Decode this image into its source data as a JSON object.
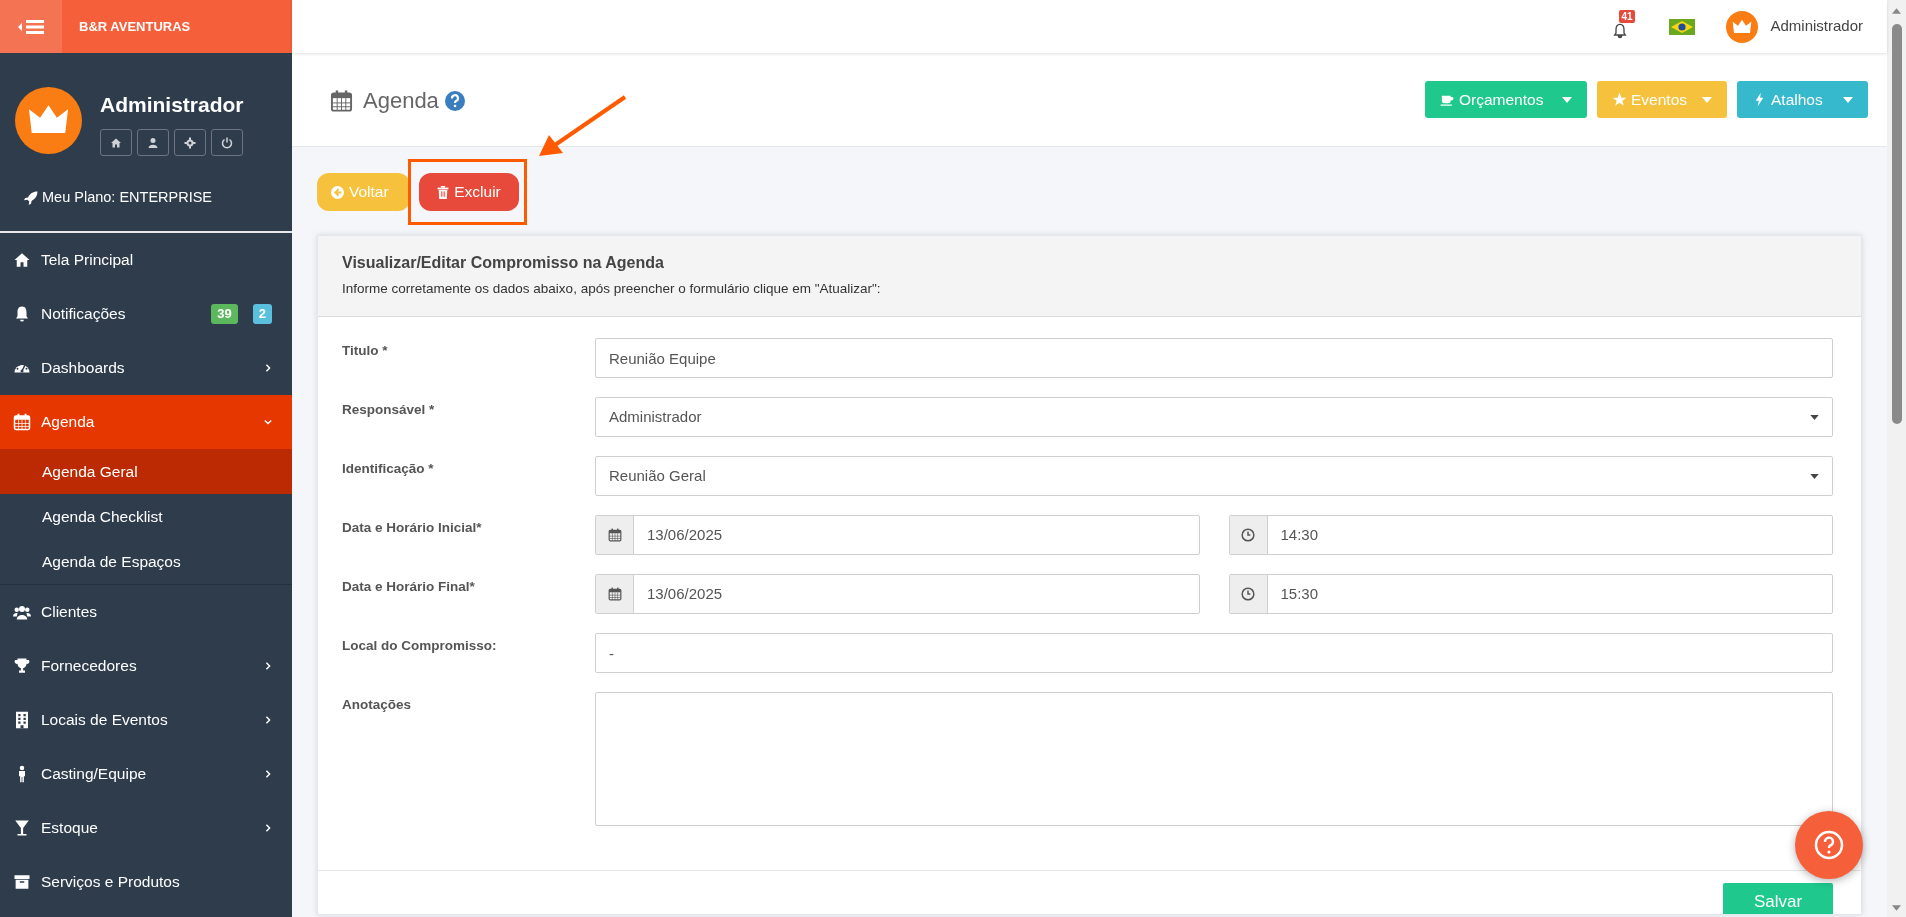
{
  "topbar": {
    "brand": "B&R AVENTURAS",
    "notification_count": "41",
    "user": "Administrador"
  },
  "profile": {
    "name": "Administrador",
    "plan": "Meu Plano: ENTERPRISE"
  },
  "sidebar": {
    "items": [
      {
        "label": "Tela Principal",
        "kind": "link",
        "selected": false
      },
      {
        "label": "Notificações",
        "kind": "link",
        "selected": false,
        "badges": [
          {
            "text": "39",
            "color": "#5cb85c"
          },
          {
            "text": "2",
            "color": "#5bc0de"
          }
        ]
      },
      {
        "label": "Dashboards",
        "kind": "menu",
        "selected": false,
        "expanded": false
      },
      {
        "label": "Agenda",
        "kind": "menu",
        "selected": true,
        "expanded": true,
        "children": [
          {
            "label": "Agenda Geral",
            "selected": true
          },
          {
            "label": "Agenda Checklist",
            "selected": false
          },
          {
            "label": "Agenda de Espaços",
            "selected": false
          }
        ]
      },
      {
        "label": "Clientes",
        "kind": "link",
        "selected": false
      },
      {
        "label": "Fornecedores",
        "kind": "menu",
        "selected": false,
        "expanded": false
      },
      {
        "label": "Locais de Eventos",
        "kind": "menu",
        "selected": false,
        "expanded": false
      },
      {
        "label": "Casting/Equipe",
        "kind": "menu",
        "selected": false,
        "expanded": false
      },
      {
        "label": "Estoque",
        "kind": "menu",
        "selected": false,
        "expanded": false
      },
      {
        "label": "Serviços e Produtos",
        "kind": "link",
        "selected": false
      }
    ]
  },
  "page_header": {
    "title": "Agenda",
    "buttons": [
      {
        "label": "Orçamentos",
        "color": "#1fc98e"
      },
      {
        "label": "Eventos",
        "color": "#f6c23e"
      },
      {
        "label": "Atalhos",
        "color": "#36b9cc"
      }
    ]
  },
  "actions": [
    {
      "label": "Voltar",
      "color": "#f6c23e",
      "highlighted": false
    },
    {
      "label": "Excluir",
      "color": "#e74a3b",
      "highlighted": true
    }
  ],
  "card": {
    "title": "Visualizar/Editar Compromisso na Agenda",
    "subtitle": "Informe corretamente os dados abaixo, após preencher o formulário clique em \"Atualizar\":",
    "fields": [
      {
        "label": "Titulo *",
        "kind": "text",
        "value": "Reunião Equipe"
      },
      {
        "label": "Responsável *",
        "kind": "select",
        "value": "Administrador"
      },
      {
        "label": "Identificação *",
        "kind": "select",
        "value": "Reunião Geral"
      },
      {
        "label": "Data e Horário Inicial*",
        "kind": "datetime",
        "date": "13/06/2025",
        "time": "14:30"
      },
      {
        "label": "Data e Horário Final*",
        "kind": "datetime",
        "date": "13/06/2025",
        "time": "15:30"
      },
      {
        "label": "Local do Compromisso:",
        "kind": "text",
        "value": "-"
      },
      {
        "label": "Anotações",
        "kind": "textarea"
      }
    ],
    "save_button": "Salvar"
  }
}
